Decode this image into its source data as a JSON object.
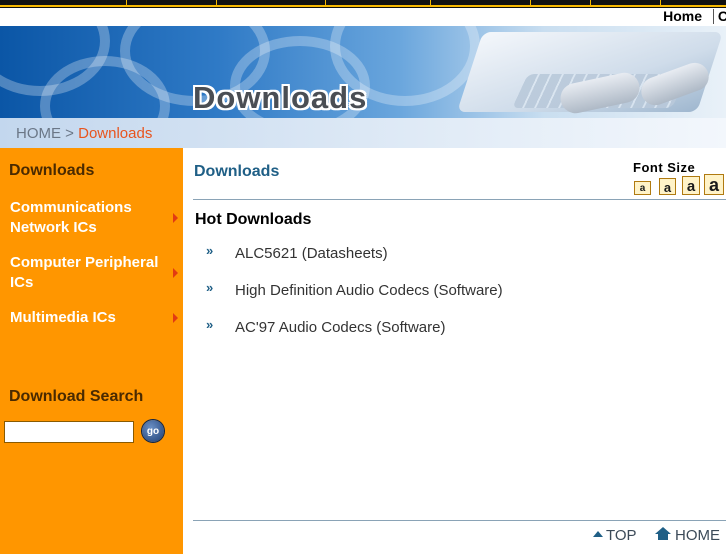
{
  "utility": {
    "home_label": "Home",
    "cut_char": "C"
  },
  "banner": {
    "title": "Downloads"
  },
  "breadcrumb": {
    "home": "HOME",
    "separator": ">",
    "current": "Downloads"
  },
  "sidebar": {
    "title": "Downloads",
    "items": [
      {
        "line1": "Communications",
        "line2": "Network ICs"
      },
      {
        "line1": "Computer Peripheral",
        "line2": "ICs"
      },
      {
        "line1": "Multimedia ICs",
        "line2": ""
      }
    ],
    "search_title": "Download Search",
    "search_placeholder": "",
    "go_label": "go"
  },
  "main": {
    "title": "Downloads",
    "font_size_label": "Font Size",
    "font_size_buttons": [
      "a",
      "a",
      "a",
      "a"
    ],
    "hot_title": "Hot Downloads",
    "downloads": [
      {
        "bullet": "»",
        "label": "ALC5621 (Datasheets)"
      },
      {
        "bullet": "»",
        "label": "High Definition Audio Codecs (Software)"
      },
      {
        "bullet": "»",
        "label": "AC'97 Audio Codecs (Software)"
      }
    ]
  },
  "footer": {
    "top_label": "TOP",
    "home_label": "HOME"
  },
  "colors": {
    "sidebar": "#ff9600",
    "accent": "#1f5f86",
    "crumb_current": "#e8541e"
  }
}
